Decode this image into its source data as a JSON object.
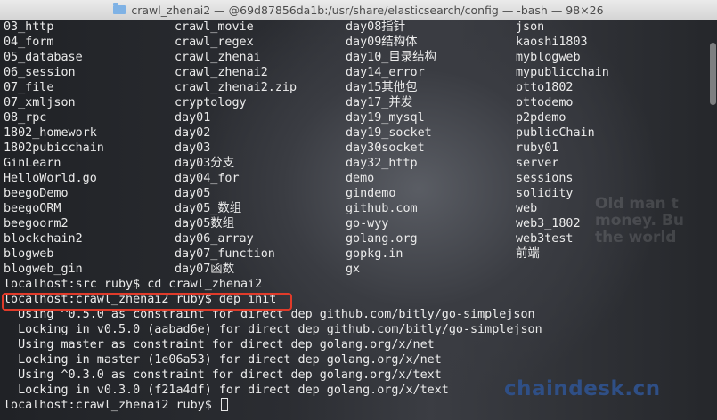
{
  "window": {
    "title": "crawl_zhenai2 — @69d87856da1b:/usr/share/elasticsearch/config — -bash — 98×26"
  },
  "listing": {
    "col1": [
      "03_http",
      "04_form",
      "05_database",
      "06_session",
      "07_file",
      "07_xmljson",
      "08_rpc",
      "1802_homework",
      "1802pubicchain",
      "GinLearn",
      "HelloWorld.go",
      "beegoDemo",
      "beegoORM",
      "beegoorm2",
      "blockchain2",
      "blogweb",
      "blogweb_gin"
    ],
    "col2": [
      "crawl_movie",
      "crawl_regex",
      "crawl_zhenai",
      "crawl_zhenai2",
      "crawl_zhenai2.zip",
      "cryptology",
      "day01",
      "day02",
      "day03",
      "day03分支",
      "day04_for",
      "day05",
      "day05_数组",
      "day05数组",
      "day06_array",
      "day07_function",
      "day07函数"
    ],
    "col3": [
      "day08指针",
      "day09结构体",
      "day10_目录结构",
      "day14_error",
      "day15其他包",
      "day17_并发",
      "day19_mysql",
      "day19_socket",
      "day30socket",
      "day32_http",
      "demo",
      "gindemo",
      "github.com",
      "go-wyy",
      "golang.org",
      "gopkg.in",
      "gx"
    ],
    "col4": [
      "json",
      "kaoshi1803",
      "myblogweb",
      "mypublicchain",
      "otto1802",
      "ottodemo",
      "p2pdemo",
      "publicChain",
      "ruby01",
      "server",
      "sessions",
      "solidity",
      "web",
      "web3_1802",
      "web3test",
      "前端"
    ]
  },
  "commands": [
    "localhost:src ruby$ cd crawl_zhenai2",
    "localhost:crawl_zhenai2 ruby$ dep init",
    "  Using ^0.5.0 as constraint for direct dep github.com/bitly/go-simplejson",
    "  Locking in v0.5.0 (aabad6e) for direct dep github.com/bitly/go-simplejson",
    "  Using master as constraint for direct dep golang.org/x/net",
    "  Locking in master (1e06a53) for direct dep golang.org/x/net",
    "  Using ^0.3.0 as constraint for direct dep golang.org/x/text",
    "  Locking in v0.3.0 (f21a4df) for direct dep golang.org/x/text"
  ],
  "prompt": "localhost:crawl_zhenai2 ruby$ ",
  "background_text": "Old man t\nmoney. Bu\nthe world",
  "watermark": "chaindesk.cn",
  "colors": {
    "highlight_border": "#e03b2a",
    "watermark": "#2f4f86",
    "text": "#ebebeb"
  }
}
